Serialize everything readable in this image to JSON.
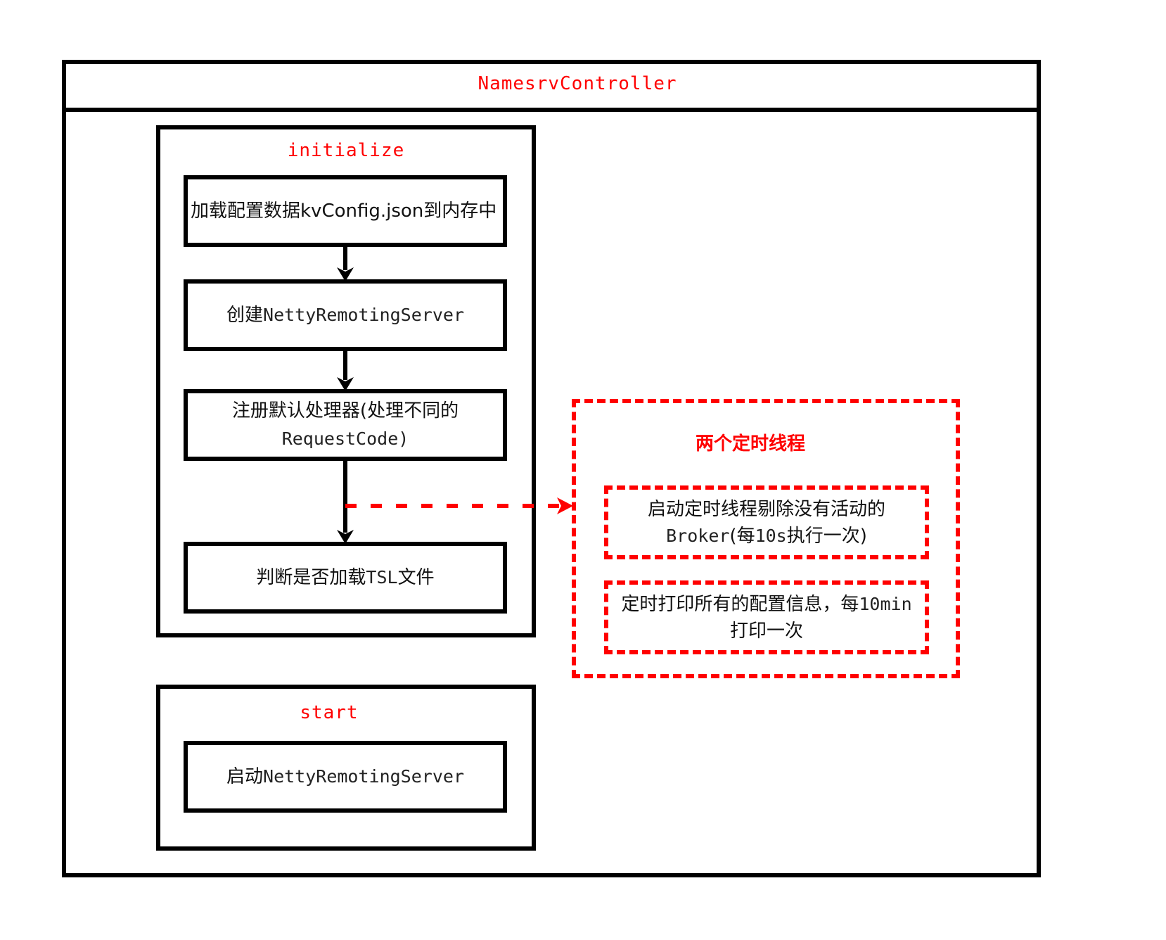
{
  "controller": {
    "title": "NamesrvController"
  },
  "initialize": {
    "title": "initialize",
    "steps": [
      {
        "text": "加载配置数据kvConfig.json到内存中"
      },
      {
        "prefix": "创建",
        "code": "NettyRemotingServer"
      },
      {
        "line1": "注册默认处理器(处理不同的",
        "line2": "RequestCode)"
      },
      {
        "prefix": "判断是否加载",
        "code": "TSL",
        "suffix": "文件"
      }
    ]
  },
  "timers": {
    "title": "两个定时线程",
    "task1": {
      "line1": "启动定时线程剔除没有活动的",
      "code": "Broker",
      "rest_a": "(每",
      "code2": "10s",
      "rest_b": "执行一次)"
    },
    "task2": {
      "line1a": "定时打印所有的配置信息，每",
      "code": "10min",
      "line2": "打印一次"
    }
  },
  "start": {
    "title": "start",
    "steps": [
      {
        "prefix": "启动",
        "code": "NettyRemotingServer"
      }
    ]
  },
  "colors": {
    "accent": "#ff0000",
    "stroke": "#000000"
  }
}
